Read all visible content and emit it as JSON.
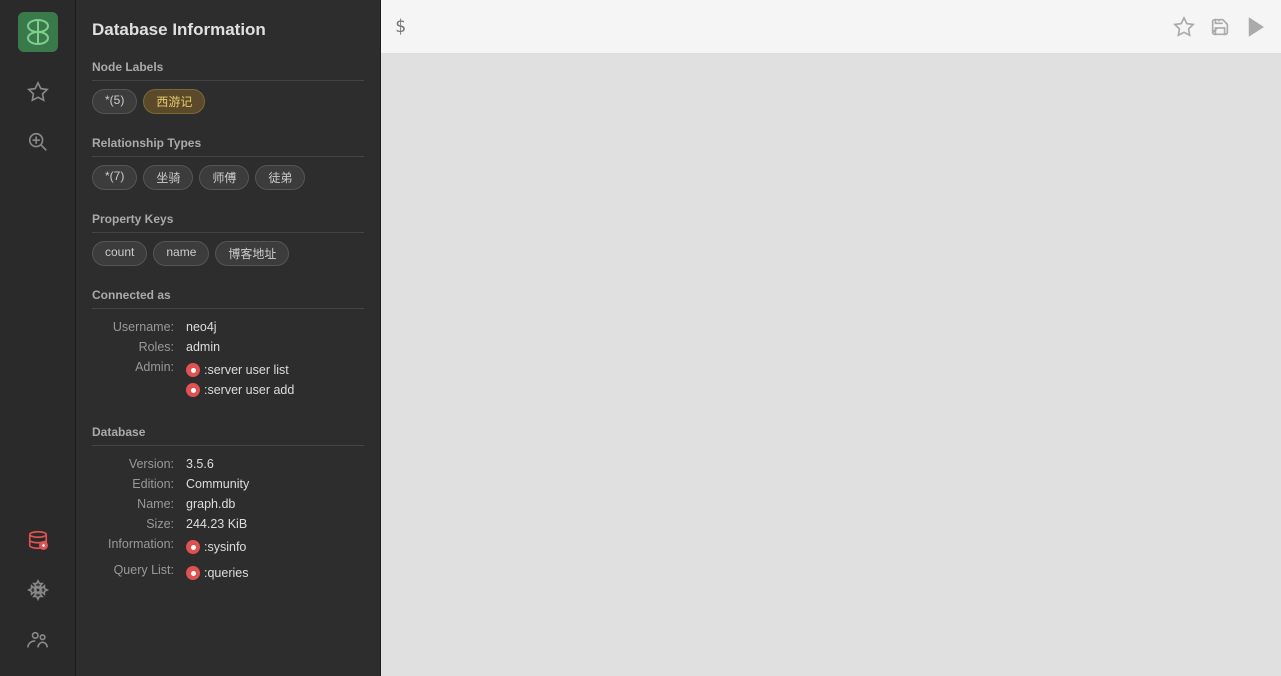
{
  "app": {
    "title": "Database Information"
  },
  "sidebar": {
    "title": "Database Information",
    "nodeLabels": {
      "sectionTitle": "Node Labels",
      "tags": [
        {
          "label": "*(5)",
          "highlight": false
        },
        {
          "label": "西游记",
          "highlight": true
        }
      ]
    },
    "relationshipTypes": {
      "sectionTitle": "Relationship Types",
      "tags": [
        {
          "label": "*(7)",
          "highlight": false
        },
        {
          "label": "坐骑",
          "highlight": false
        },
        {
          "label": "师傅",
          "highlight": false
        },
        {
          "label": "徒弟",
          "highlight": false
        }
      ]
    },
    "propertyKeys": {
      "sectionTitle": "Property Keys",
      "tags": [
        {
          "label": "count",
          "highlight": false
        },
        {
          "label": "name",
          "highlight": false
        },
        {
          "label": "博客地址",
          "highlight": false
        }
      ]
    },
    "connectedAs": {
      "sectionTitle": "Connected as",
      "username_label": "Username:",
      "username_value": "neo4j",
      "roles_label": "Roles:",
      "roles_value": "admin",
      "admin_label": "Admin:",
      "admin_links": [
        ":server user list",
        ":server user add"
      ]
    },
    "database": {
      "sectionTitle": "Database",
      "version_label": "Version:",
      "version_value": "3.5.6",
      "edition_label": "Edition:",
      "edition_value": "Community",
      "name_label": "Name:",
      "name_value": "graph.db",
      "size_label": "Size:",
      "size_value": "244.23 KiB",
      "information_label": "Information:",
      "information_link": ":sysinfo",
      "querylist_label": "Query List:",
      "querylist_link": ":queries"
    }
  },
  "queryBar": {
    "placeholder": "$"
  },
  "icons": {
    "logo": "🌿",
    "star": "☆",
    "search": "🔍",
    "database": "🗄",
    "settings": "⚙",
    "bug": "🐛",
    "bell": "🔔",
    "save": "💾",
    "run": "▶"
  }
}
